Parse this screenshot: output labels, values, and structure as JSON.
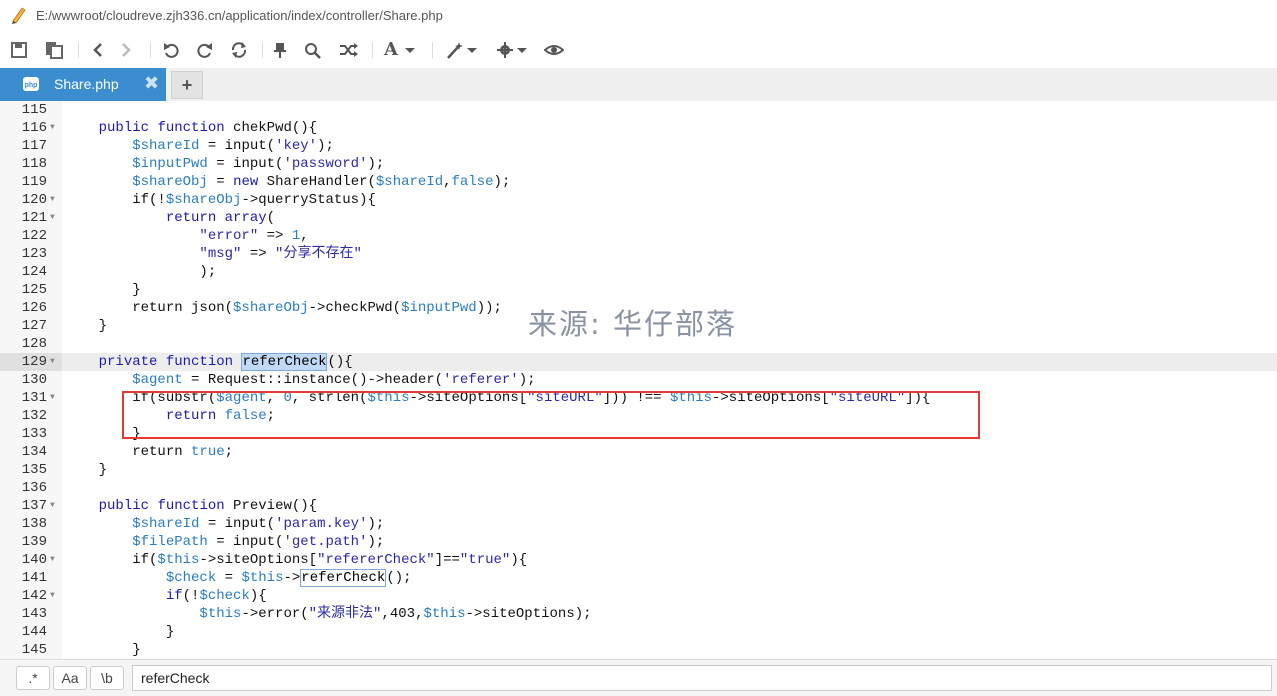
{
  "window": {
    "file_path": "E:/wwwroot/cloudreve.zjh336.cn/application/index/controller/Share.php"
  },
  "toolbar": {
    "icons": [
      "save-icon",
      "save-all-icon",
      "back-icon",
      "forward-icon",
      "undo-icon",
      "redo-icon",
      "refresh-icon",
      "pin-icon",
      "search-icon",
      "replace-icon",
      "font-icon",
      "magic-icon",
      "settings-icon",
      "preview-icon"
    ],
    "font_glyph": "A"
  },
  "tabs": [
    {
      "label": "Share.php",
      "close": "✖",
      "active": true
    }
  ],
  "add_tab": "+",
  "watermark": "来源: 华仔部落",
  "code_lines": [
    {
      "n": "115",
      "fold": false,
      "tokens": []
    },
    {
      "n": "116",
      "fold": true,
      "tokens": [
        [
          "    ",
          "plain"
        ],
        [
          "public",
          "kw"
        ],
        [
          " ",
          "plain"
        ],
        [
          "function",
          "kw"
        ],
        [
          " chekPwd(){",
          "plain"
        ]
      ]
    },
    {
      "n": "117",
      "fold": false,
      "tokens": [
        [
          "        ",
          "plain"
        ],
        [
          "$shareId",
          "var"
        ],
        [
          " = input(",
          "plain"
        ],
        [
          "'key'",
          "str"
        ],
        [
          ");",
          "plain"
        ]
      ]
    },
    {
      "n": "118",
      "fold": false,
      "tokens": [
        [
          "        ",
          "plain"
        ],
        [
          "$inputPwd",
          "var"
        ],
        [
          " = input(",
          "plain"
        ],
        [
          "'password'",
          "str"
        ],
        [
          ");",
          "plain"
        ]
      ]
    },
    {
      "n": "119",
      "fold": false,
      "tokens": [
        [
          "        ",
          "plain"
        ],
        [
          "$shareObj",
          "var"
        ],
        [
          " = ",
          "plain"
        ],
        [
          "new",
          "kw"
        ],
        [
          " ShareHandler(",
          "plain"
        ],
        [
          "$shareId",
          "var"
        ],
        [
          ",",
          "plain"
        ],
        [
          "false",
          "var"
        ],
        [
          ");",
          "plain"
        ]
      ]
    },
    {
      "n": "120",
      "fold": true,
      "tokens": [
        [
          "        if(!",
          "plain"
        ],
        [
          "$shareObj",
          "var"
        ],
        [
          "->querryStatus){",
          "plain"
        ]
      ]
    },
    {
      "n": "121",
      "fold": true,
      "tokens": [
        [
          "            ",
          "plain"
        ],
        [
          "return",
          "kw"
        ],
        [
          " ",
          "plain"
        ],
        [
          "array",
          "kw"
        ],
        [
          "(",
          "plain"
        ]
      ]
    },
    {
      "n": "122",
      "fold": false,
      "tokens": [
        [
          "                ",
          "plain"
        ],
        [
          "\"error\"",
          "str"
        ],
        [
          " => ",
          "plain"
        ],
        [
          "1",
          "num"
        ],
        [
          ",",
          "plain"
        ]
      ]
    },
    {
      "n": "123",
      "fold": false,
      "tokens": [
        [
          "                ",
          "plain"
        ],
        [
          "\"msg\"",
          "str"
        ],
        [
          " => ",
          "plain"
        ],
        [
          "\"分享不存在\"",
          "str"
        ]
      ]
    },
    {
      "n": "124",
      "fold": false,
      "tokens": [
        [
          "                );",
          "plain"
        ]
      ]
    },
    {
      "n": "125",
      "fold": false,
      "tokens": [
        [
          "        }",
          "plain"
        ]
      ]
    },
    {
      "n": "126",
      "fold": false,
      "tokens": [
        [
          "        return json(",
          "plain"
        ],
        [
          "$shareObj",
          "var"
        ],
        [
          "->checkPwd(",
          "plain"
        ],
        [
          "$inputPwd",
          "var"
        ],
        [
          "));",
          "plain"
        ]
      ]
    },
    {
      "n": "127",
      "fold": false,
      "tokens": [
        [
          "    }",
          "plain"
        ]
      ]
    },
    {
      "n": "128",
      "fold": false,
      "tokens": []
    },
    {
      "n": "129",
      "fold": true,
      "active": true,
      "tokens": [
        [
          "    ",
          "plain"
        ],
        [
          "private",
          "kw"
        ],
        [
          " ",
          "plain"
        ],
        [
          "function",
          "kw"
        ],
        [
          " ",
          "plain"
        ],
        [
          "referCheck",
          "hl"
        ],
        [
          "(){",
          "plain"
        ]
      ]
    },
    {
      "n": "130",
      "fold": false,
      "tokens": [
        [
          "        ",
          "plain"
        ],
        [
          "$agent",
          "var"
        ],
        [
          " = Request::instance()->header(",
          "plain"
        ],
        [
          "'referer'",
          "str"
        ],
        [
          ");",
          "plain"
        ]
      ]
    },
    {
      "n": "131",
      "fold": true,
      "tokens": [
        [
          "        if(substr(",
          "plain"
        ],
        [
          "$agent",
          "var"
        ],
        [
          ", ",
          "plain"
        ],
        [
          "0",
          "num"
        ],
        [
          ", strlen(",
          "plain"
        ],
        [
          "$this",
          "var"
        ],
        [
          "->siteOptions[",
          "plain"
        ],
        [
          "\"siteURL\"",
          "str"
        ],
        [
          "])) !== ",
          "plain"
        ],
        [
          "$this",
          "var"
        ],
        [
          "->siteOptions[",
          "plain"
        ],
        [
          "\"siteURL\"",
          "str"
        ],
        [
          "]){",
          "plain"
        ]
      ]
    },
    {
      "n": "132",
      "fold": false,
      "tokens": [
        [
          "            ",
          "plain"
        ],
        [
          "return",
          "kw"
        ],
        [
          " ",
          "plain"
        ],
        [
          "false",
          "var"
        ],
        [
          ";",
          "plain"
        ]
      ]
    },
    {
      "n": "133",
      "fold": false,
      "tokens": [
        [
          "        }",
          "plain"
        ]
      ]
    },
    {
      "n": "134",
      "fold": false,
      "tokens": [
        [
          "        return ",
          "plain"
        ],
        [
          "true",
          "var"
        ],
        [
          ";",
          "plain"
        ]
      ]
    },
    {
      "n": "135",
      "fold": false,
      "tokens": [
        [
          "    }",
          "plain"
        ]
      ]
    },
    {
      "n": "136",
      "fold": false,
      "tokens": []
    },
    {
      "n": "137",
      "fold": true,
      "tokens": [
        [
          "    ",
          "plain"
        ],
        [
          "public",
          "kw"
        ],
        [
          " ",
          "plain"
        ],
        [
          "function",
          "kw"
        ],
        [
          " Preview(){",
          "plain"
        ]
      ]
    },
    {
      "n": "138",
      "fold": false,
      "tokens": [
        [
          "        ",
          "plain"
        ],
        [
          "$shareId",
          "var"
        ],
        [
          " = input(",
          "plain"
        ],
        [
          "'param.key'",
          "str"
        ],
        [
          ");",
          "plain"
        ]
      ]
    },
    {
      "n": "139",
      "fold": false,
      "tokens": [
        [
          "        ",
          "plain"
        ],
        [
          "$filePath",
          "var"
        ],
        [
          " = input(",
          "plain"
        ],
        [
          "'get.path'",
          "str"
        ],
        [
          ");",
          "plain"
        ]
      ]
    },
    {
      "n": "140",
      "fold": true,
      "tokens": [
        [
          "        if(",
          "plain"
        ],
        [
          "$this",
          "var"
        ],
        [
          "->siteOptions[",
          "plain"
        ],
        [
          "\"refererCheck\"",
          "str"
        ],
        [
          "]==",
          "plain"
        ],
        [
          "\"true\"",
          "str"
        ],
        [
          "){",
          "plain"
        ]
      ]
    },
    {
      "n": "141",
      "fold": false,
      "tokens": [
        [
          "            ",
          "plain"
        ],
        [
          "$check",
          "var"
        ],
        [
          " = ",
          "plain"
        ],
        [
          "$this",
          "var"
        ],
        [
          "->",
          "plain"
        ],
        [
          "referCheck",
          "match"
        ],
        [
          "();",
          "plain"
        ]
      ]
    },
    {
      "n": "142",
      "fold": true,
      "tokens": [
        [
          "            ",
          "plain"
        ],
        [
          "if",
          "kw"
        ],
        [
          "(!",
          "plain"
        ],
        [
          "$check",
          "var"
        ],
        [
          "){",
          "plain"
        ]
      ]
    },
    {
      "n": "143",
      "fold": false,
      "tokens": [
        [
          "                ",
          "plain"
        ],
        [
          "$this",
          "var"
        ],
        [
          "->error(",
          "plain"
        ],
        [
          "\"来源非法\"",
          "str"
        ],
        [
          ",403,",
          "plain"
        ],
        [
          "$this",
          "var"
        ],
        [
          "->siteOptions);",
          "plain"
        ]
      ]
    },
    {
      "n": "144",
      "fold": false,
      "tokens": [
        [
          "            }",
          "plain"
        ]
      ]
    },
    {
      "n": "145",
      "fold": false,
      "tokens": [
        [
          "        }",
          "plain"
        ]
      ]
    }
  ],
  "find": {
    "regex_label": ".*",
    "case_label": "Aa",
    "word_label": "\\b",
    "query": "referCheck"
  },
  "colors": {
    "tab_active": "#3c8dcf",
    "highlight_box": "#e53935",
    "keyword": "#1b1bb0",
    "variable": "#2a7dbf"
  }
}
